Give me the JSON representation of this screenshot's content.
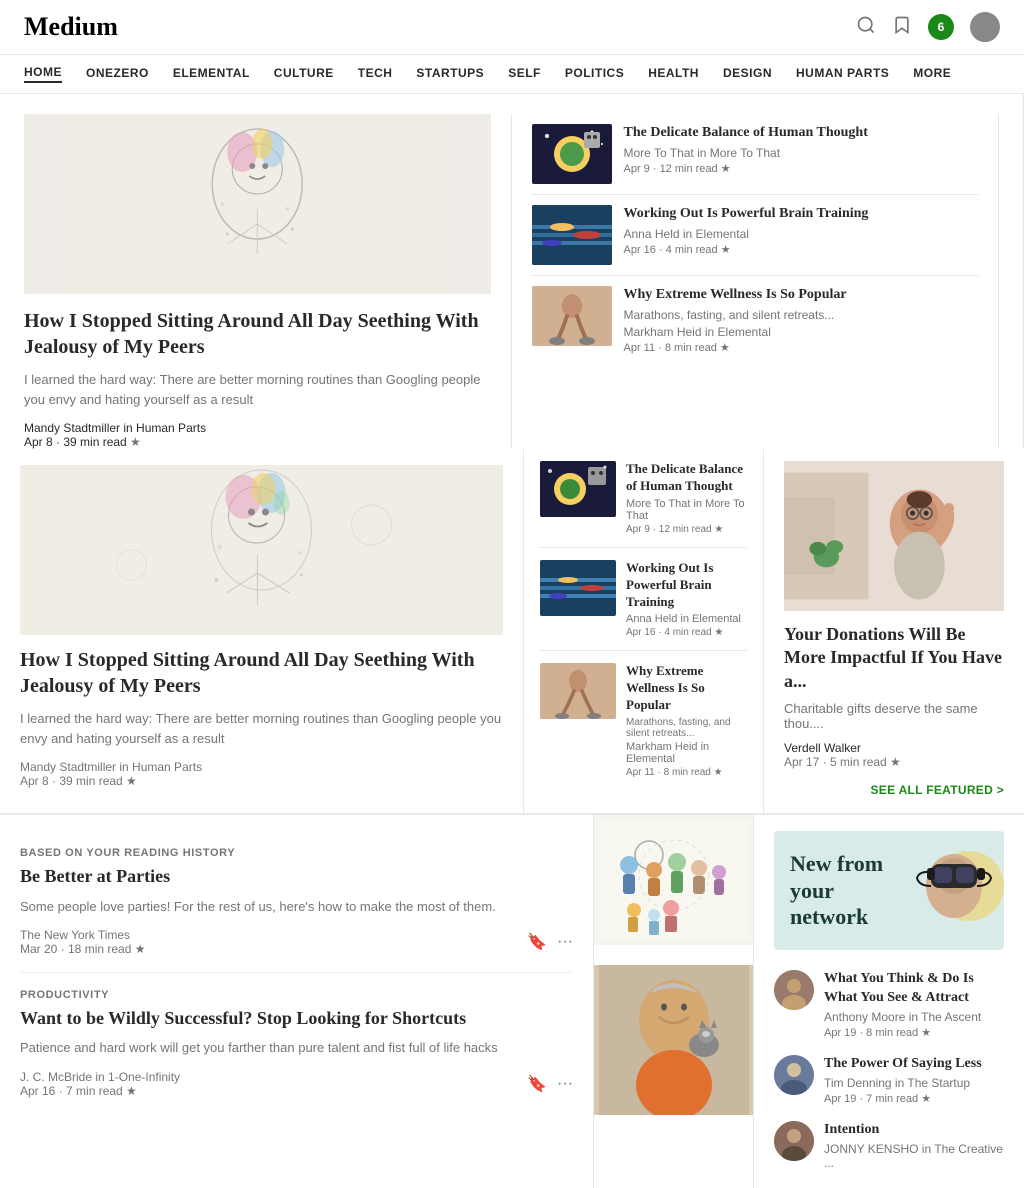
{
  "header": {
    "logo": "Medium",
    "notification_count": "6"
  },
  "nav": {
    "items": [
      {
        "label": "HOME",
        "active": true
      },
      {
        "label": "ONEZERO",
        "active": false
      },
      {
        "label": "ELEMENTAL",
        "active": false
      },
      {
        "label": "CULTURE",
        "active": false
      },
      {
        "label": "TECH",
        "active": false
      },
      {
        "label": "STARTUPS",
        "active": false
      },
      {
        "label": "SELF",
        "active": false
      },
      {
        "label": "POLITICS",
        "active": false
      },
      {
        "label": "HEALTH",
        "active": false
      },
      {
        "label": "DESIGN",
        "active": false
      },
      {
        "label": "HUMAN PARTS",
        "active": false
      },
      {
        "label": "MORE",
        "active": false
      }
    ]
  },
  "hero": {
    "title": "How I Stopped Sitting Around All Day Seething With Jealousy of My Peers",
    "subtitle": "I learned the hard way: There are better morning routines than Googling people you envy and hating yourself as a result",
    "author": "Mandy Stadtmiller in Human Parts",
    "meta": "Apr 8 · 39 min read"
  },
  "middle_articles": [
    {
      "title": "The Delicate Balance of Human Thought",
      "pub": "More To That in More To That",
      "meta": "Apr 9 · 12 min read",
      "bg": "#f5d060"
    },
    {
      "title": "Working Out Is Powerful Brain Training",
      "pub": "Anna Held in Elemental",
      "meta": "Apr 16 · 4 min read",
      "bg": "#4a8ab5"
    },
    {
      "title": "Why Extreme Wellness Is So Popular",
      "desc": "Marathons, fasting, and silent retreats...",
      "pub": "Markham Heid in Elemental",
      "meta": "Apr 11 · 8 min read",
      "bg": "#c9b99a"
    }
  ],
  "right_featured": {
    "title": "Your Donations Will Be More Impactful If You Have a...",
    "subtitle": "Charitable gifts deserve the same thou....",
    "author": "Verdell Walker",
    "meta": "Apr 17 · 5 min read"
  },
  "see_all_label": "SEE ALL FEATURED >",
  "bottom_articles": [
    {
      "category": "BASED ON YOUR READING HISTORY",
      "title": "Be Better at Parties",
      "desc": "Some people love parties! For the rest of us, here's how to make the most of them.",
      "author": "The New York Times",
      "meta": "Mar 20 · 18 min read"
    },
    {
      "category": "PRODUCTIVITY",
      "title": "Want to be Wildly Successful? Stop Looking for Shortcuts",
      "desc": "Patience and hard work will get you farther than pure talent and fist full of life hacks",
      "author": "J. C. McBride in 1-One-Infinity",
      "meta": "Apr 16 · 7 min read"
    }
  ],
  "network": {
    "title": "New from your network",
    "articles": [
      {
        "title": "What You Think & Do Is What You See & Attract",
        "pub": "Anthony Moore in The Ascent",
        "meta": "Apr 19 · 8 min read",
        "avatar_color": "#8a6a5a"
      },
      {
        "title": "The Power Of Saying Less",
        "pub": "Tim Denning in The Startup",
        "meta": "Apr 19 · 7 min read",
        "avatar_color": "#5a6a8a"
      },
      {
        "title": "Intention",
        "pub": "JONNY KENSHO in The Creative ...",
        "meta": "",
        "avatar_color": "#7a5a4a"
      }
    ]
  }
}
